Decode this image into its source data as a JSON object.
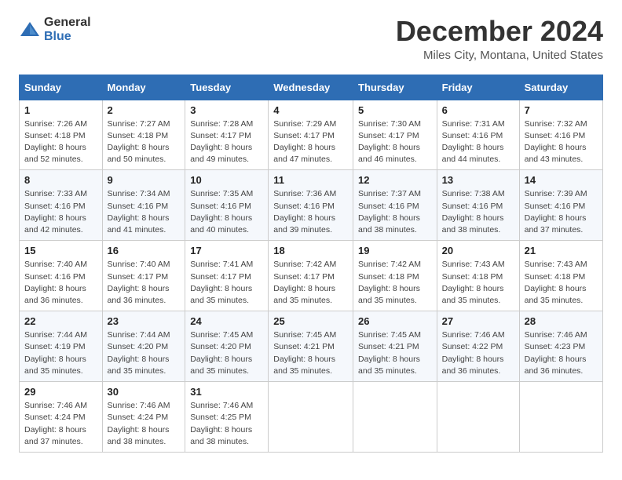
{
  "header": {
    "logo_general": "General",
    "logo_blue": "Blue",
    "month_title": "December 2024",
    "location": "Miles City, Montana, United States"
  },
  "days_of_week": [
    "Sunday",
    "Monday",
    "Tuesday",
    "Wednesday",
    "Thursday",
    "Friday",
    "Saturday"
  ],
  "weeks": [
    [
      {
        "day": "1",
        "sunrise": "Sunrise: 7:26 AM",
        "sunset": "Sunset: 4:18 PM",
        "daylight": "Daylight: 8 hours and 52 minutes."
      },
      {
        "day": "2",
        "sunrise": "Sunrise: 7:27 AM",
        "sunset": "Sunset: 4:18 PM",
        "daylight": "Daylight: 8 hours and 50 minutes."
      },
      {
        "day": "3",
        "sunrise": "Sunrise: 7:28 AM",
        "sunset": "Sunset: 4:17 PM",
        "daylight": "Daylight: 8 hours and 49 minutes."
      },
      {
        "day": "4",
        "sunrise": "Sunrise: 7:29 AM",
        "sunset": "Sunset: 4:17 PM",
        "daylight": "Daylight: 8 hours and 47 minutes."
      },
      {
        "day": "5",
        "sunrise": "Sunrise: 7:30 AM",
        "sunset": "Sunset: 4:17 PM",
        "daylight": "Daylight: 8 hours and 46 minutes."
      },
      {
        "day": "6",
        "sunrise": "Sunrise: 7:31 AM",
        "sunset": "Sunset: 4:16 PM",
        "daylight": "Daylight: 8 hours and 44 minutes."
      },
      {
        "day": "7",
        "sunrise": "Sunrise: 7:32 AM",
        "sunset": "Sunset: 4:16 PM",
        "daylight": "Daylight: 8 hours and 43 minutes."
      }
    ],
    [
      {
        "day": "8",
        "sunrise": "Sunrise: 7:33 AM",
        "sunset": "Sunset: 4:16 PM",
        "daylight": "Daylight: 8 hours and 42 minutes."
      },
      {
        "day": "9",
        "sunrise": "Sunrise: 7:34 AM",
        "sunset": "Sunset: 4:16 PM",
        "daylight": "Daylight: 8 hours and 41 minutes."
      },
      {
        "day": "10",
        "sunrise": "Sunrise: 7:35 AM",
        "sunset": "Sunset: 4:16 PM",
        "daylight": "Daylight: 8 hours and 40 minutes."
      },
      {
        "day": "11",
        "sunrise": "Sunrise: 7:36 AM",
        "sunset": "Sunset: 4:16 PM",
        "daylight": "Daylight: 8 hours and 39 minutes."
      },
      {
        "day": "12",
        "sunrise": "Sunrise: 7:37 AM",
        "sunset": "Sunset: 4:16 PM",
        "daylight": "Daylight: 8 hours and 38 minutes."
      },
      {
        "day": "13",
        "sunrise": "Sunrise: 7:38 AM",
        "sunset": "Sunset: 4:16 PM",
        "daylight": "Daylight: 8 hours and 38 minutes."
      },
      {
        "day": "14",
        "sunrise": "Sunrise: 7:39 AM",
        "sunset": "Sunset: 4:16 PM",
        "daylight": "Daylight: 8 hours and 37 minutes."
      }
    ],
    [
      {
        "day": "15",
        "sunrise": "Sunrise: 7:40 AM",
        "sunset": "Sunset: 4:16 PM",
        "daylight": "Daylight: 8 hours and 36 minutes."
      },
      {
        "day": "16",
        "sunrise": "Sunrise: 7:40 AM",
        "sunset": "Sunset: 4:17 PM",
        "daylight": "Daylight: 8 hours and 36 minutes."
      },
      {
        "day": "17",
        "sunrise": "Sunrise: 7:41 AM",
        "sunset": "Sunset: 4:17 PM",
        "daylight": "Daylight: 8 hours and 35 minutes."
      },
      {
        "day": "18",
        "sunrise": "Sunrise: 7:42 AM",
        "sunset": "Sunset: 4:17 PM",
        "daylight": "Daylight: 8 hours and 35 minutes."
      },
      {
        "day": "19",
        "sunrise": "Sunrise: 7:42 AM",
        "sunset": "Sunset: 4:18 PM",
        "daylight": "Daylight: 8 hours and 35 minutes."
      },
      {
        "day": "20",
        "sunrise": "Sunrise: 7:43 AM",
        "sunset": "Sunset: 4:18 PM",
        "daylight": "Daylight: 8 hours and 35 minutes."
      },
      {
        "day": "21",
        "sunrise": "Sunrise: 7:43 AM",
        "sunset": "Sunset: 4:18 PM",
        "daylight": "Daylight: 8 hours and 35 minutes."
      }
    ],
    [
      {
        "day": "22",
        "sunrise": "Sunrise: 7:44 AM",
        "sunset": "Sunset: 4:19 PM",
        "daylight": "Daylight: 8 hours and 35 minutes."
      },
      {
        "day": "23",
        "sunrise": "Sunrise: 7:44 AM",
        "sunset": "Sunset: 4:20 PM",
        "daylight": "Daylight: 8 hours and 35 minutes."
      },
      {
        "day": "24",
        "sunrise": "Sunrise: 7:45 AM",
        "sunset": "Sunset: 4:20 PM",
        "daylight": "Daylight: 8 hours and 35 minutes."
      },
      {
        "day": "25",
        "sunrise": "Sunrise: 7:45 AM",
        "sunset": "Sunset: 4:21 PM",
        "daylight": "Daylight: 8 hours and 35 minutes."
      },
      {
        "day": "26",
        "sunrise": "Sunrise: 7:45 AM",
        "sunset": "Sunset: 4:21 PM",
        "daylight": "Daylight: 8 hours and 35 minutes."
      },
      {
        "day": "27",
        "sunrise": "Sunrise: 7:46 AM",
        "sunset": "Sunset: 4:22 PM",
        "daylight": "Daylight: 8 hours and 36 minutes."
      },
      {
        "day": "28",
        "sunrise": "Sunrise: 7:46 AM",
        "sunset": "Sunset: 4:23 PM",
        "daylight": "Daylight: 8 hours and 36 minutes."
      }
    ],
    [
      {
        "day": "29",
        "sunrise": "Sunrise: 7:46 AM",
        "sunset": "Sunset: 4:24 PM",
        "daylight": "Daylight: 8 hours and 37 minutes."
      },
      {
        "day": "30",
        "sunrise": "Sunrise: 7:46 AM",
        "sunset": "Sunset: 4:24 PM",
        "daylight": "Daylight: 8 hours and 38 minutes."
      },
      {
        "day": "31",
        "sunrise": "Sunrise: 7:46 AM",
        "sunset": "Sunset: 4:25 PM",
        "daylight": "Daylight: 8 hours and 38 minutes."
      },
      null,
      null,
      null,
      null
    ]
  ]
}
